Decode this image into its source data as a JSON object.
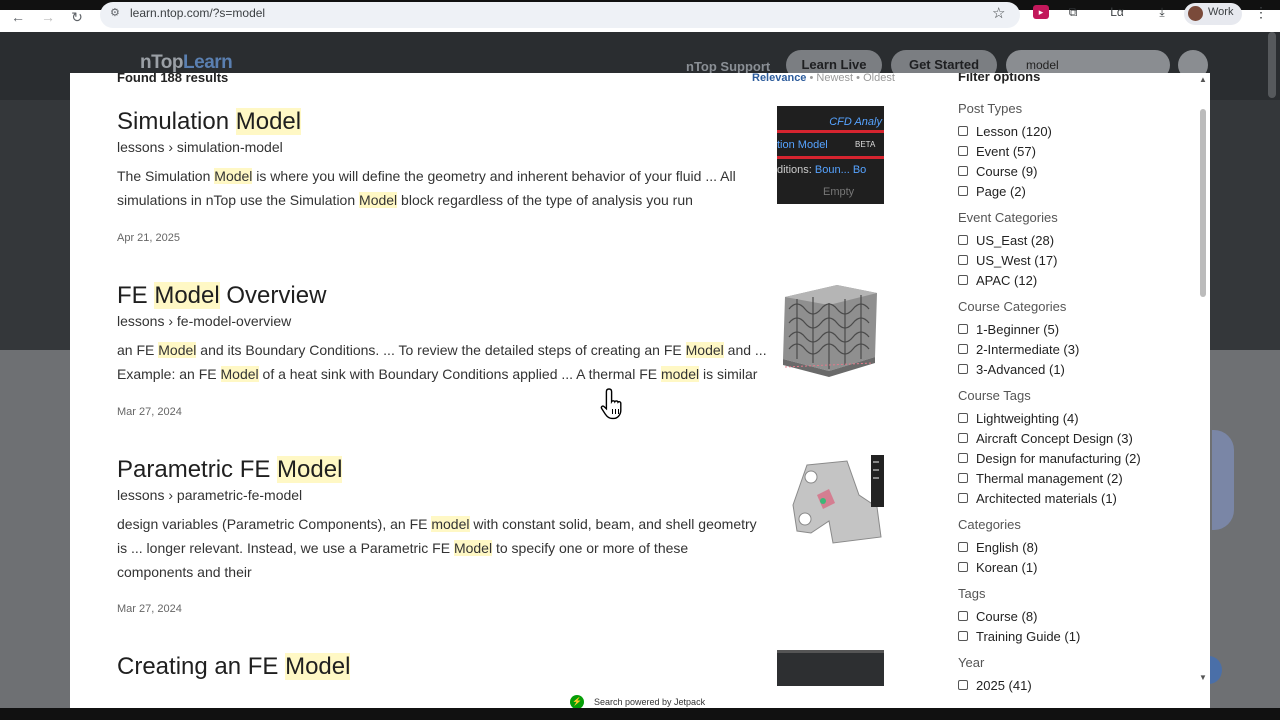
{
  "browser": {
    "url": "learn.ntop.com/?s=model",
    "profile_label": "Work"
  },
  "site": {
    "logo_part1": "nTop",
    "logo_part2": "Learn",
    "support_link": "nTop Support",
    "learn_live": "Learn Live",
    "get_started": "Get Started",
    "search_value": "model"
  },
  "results": {
    "found_text": "Found 188 results",
    "sort": {
      "relevance": "Relevance",
      "newest": "Newest",
      "oldest": "Oldest",
      "sep": "•"
    },
    "items": [
      {
        "title_pre": "Simulation ",
        "title_hl": "Model",
        "title_post": "",
        "path": "lessons › simulation-model",
        "date": "Apr 21, 2025"
      },
      {
        "title_pre": "FE ",
        "title_hl": "Model",
        "title_post": " Overview",
        "path": "lessons › fe-model-overview",
        "date": "Mar 27, 2024"
      },
      {
        "title_pre": "Parametric FE ",
        "title_hl": "Model",
        "title_post": "",
        "path": "lessons › parametric-fe-model",
        "date": "Mar 27, 2024"
      },
      {
        "title_pre": "Creating an FE ",
        "title_hl": "Model",
        "title_post": ""
      }
    ],
    "snippets": {
      "s1": [
        "The Simulation ",
        "Model",
        " is where you will define the geometry and inherent behavior of your fluid ... All simulations in nTop use the Simulation ",
        "Model",
        " block regardless of the type of analysis you run"
      ],
      "s2": [
        "an FE ",
        "Model",
        " and its Boundary Conditions. ... To review the detailed steps of creating an FE ",
        "Model",
        " and ... Example: an FE ",
        "Model",
        " of a heat sink with Boundary Conditions applied ... A thermal FE ",
        "model",
        " is similar"
      ],
      "s3": [
        "design variables (Parametric Components), an FE ",
        "model",
        " with constant solid, beam, and shell geometry is ... longer relevant. Instead, we use a Parametric FE ",
        "Model",
        " to specify one or more of these components and their"
      ]
    },
    "thumb1": {
      "line1": "CFD Analy",
      "line2": "tion Model",
      "beta": "BETA",
      "line3a": "ditions:",
      "line3b": "Boun...",
      "line3c": "Bo",
      "line4": "Empty"
    }
  },
  "filters": {
    "title": "Filter options",
    "groups": [
      {
        "heading": "Post Types",
        "options": [
          "Lesson (120)",
          "Event (57)",
          "Course (9)",
          "Page (2)"
        ]
      },
      {
        "heading": "Event Categories",
        "options": [
          "US_East (28)",
          "US_West (17)",
          "APAC (12)"
        ]
      },
      {
        "heading": "Course Categories",
        "options": [
          "1-Beginner (5)",
          "2-Intermediate (3)",
          "3-Advanced (1)"
        ]
      },
      {
        "heading": "Course Tags",
        "options": [
          "Lightweighting (4)",
          "Aircraft Concept Design (3)",
          "Design for manufacturing (2)",
          "Thermal management (2)",
          "Architected materials (1)"
        ]
      },
      {
        "heading": "Categories",
        "options": [
          "English (8)",
          "Korean (1)"
        ]
      },
      {
        "heading": "Tags",
        "options": [
          "Course (8)",
          "Training Guide (1)"
        ]
      },
      {
        "heading": "Year",
        "options": [
          "2025 (41)"
        ]
      }
    ]
  },
  "footer": {
    "powered": "Search powered by Jetpack"
  },
  "icons": {
    "back": "arrow-left-icon",
    "forward": "arrow-right-icon",
    "reload": "reload-icon",
    "star": "star-icon",
    "checkbox": "checkbox-icon",
    "jetpack": "jetpack-icon",
    "cursor": "hand-pointer-icon"
  },
  "colors": {
    "highlight": "#fff8c5",
    "sort_active": "#2d5c9c",
    "jetpack": "#069e08"
  }
}
